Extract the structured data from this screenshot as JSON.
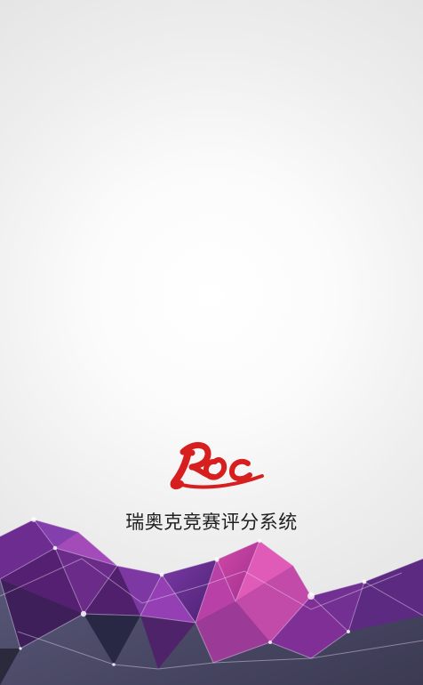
{
  "splash": {
    "logo_text": "Roc",
    "app_title": "瑞奥克竞赛评分系统"
  },
  "theme": {
    "background_top": "#ffffff",
    "background_bottom": "#dedede",
    "logo_red": "#d71f1f",
    "title_color": "#1f1f1f",
    "polygon_purple": "#6f2c98",
    "polygon_magenta": "#c0379a",
    "polygon_dark": "#4c4b67"
  }
}
